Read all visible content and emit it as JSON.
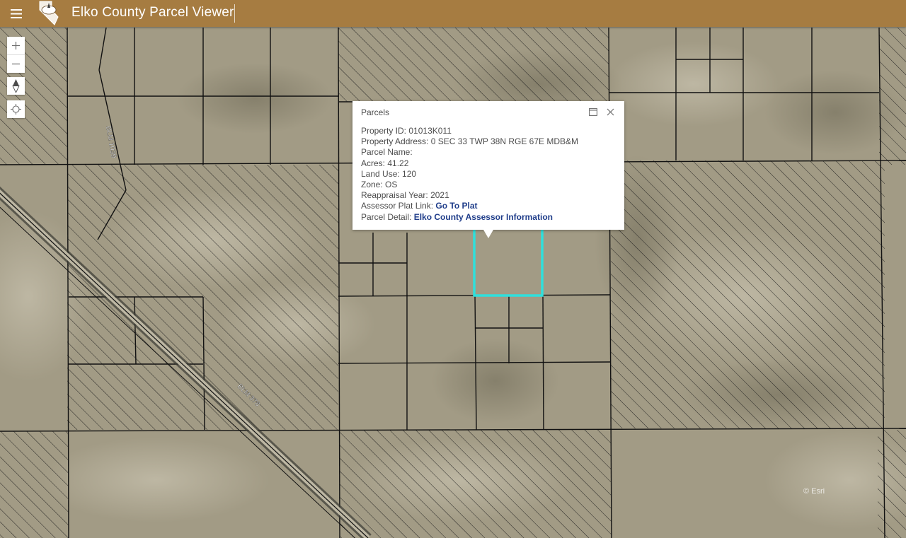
{
  "header": {
    "menu_icon": "hamburger-menu-icon",
    "logo": "elko-county-logo",
    "title": "Elko County Parcel Viewer",
    "background_color": "#a67c41"
  },
  "map": {
    "controls": {
      "zoom_in": "+",
      "zoom_out": "−",
      "compass_icon": "compass-icon",
      "locate_icon": "locate-icon"
    },
    "road_labels": [
      "BLM 1039",
      "BLM 378"
    ],
    "selected_parcel_color": "#2fe0dc",
    "attribution": "© Esri"
  },
  "popup": {
    "title": "Parcels",
    "dock_icon": "dock-icon",
    "close_icon": "close-icon",
    "fields": [
      {
        "label": "Property ID:",
        "value": "01013K011"
      },
      {
        "label": "Property Address:",
        "value": "0 SEC 33 TWP 38N RGE 67E MDB&M"
      },
      {
        "label": "Parcel Name:",
        "value": ""
      },
      {
        "label": "Acres:",
        "value": "41.22"
      },
      {
        "label": "Land Use:",
        "value": "120"
      },
      {
        "label": "Zone:",
        "value": "OS"
      },
      {
        "label": "Reappraisal Year:",
        "value": "2021"
      }
    ],
    "links": [
      {
        "label": "Assessor Plat Link:",
        "text": "Go To Plat"
      },
      {
        "label": "Parcel Detail:",
        "text": "Elko County Assessor Information"
      }
    ]
  }
}
